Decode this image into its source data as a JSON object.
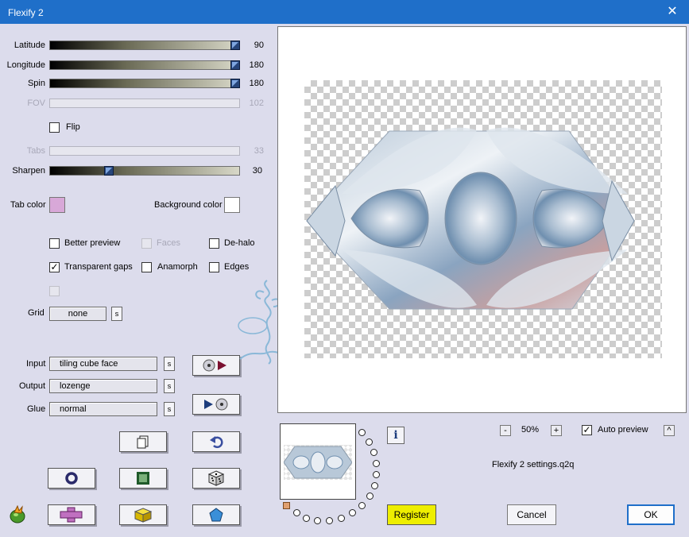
{
  "window": {
    "title": "Flexify 2",
    "close_icon": "close-icon"
  },
  "sliders": [
    {
      "label": "Latitude",
      "value": "90",
      "enabled": true,
      "level": 1.0
    },
    {
      "label": "Longitude",
      "value": "180",
      "enabled": true,
      "level": 1.0
    },
    {
      "label": "Spin",
      "value": "180",
      "enabled": true,
      "level": 1.0
    },
    {
      "label": "FOV",
      "value": "102",
      "enabled": false
    },
    {
      "label": "Tabs",
      "value": "33",
      "enabled": false
    },
    {
      "label": "Sharpen",
      "value": "30",
      "enabled": true,
      "level": 0.3
    }
  ],
  "flip": {
    "label": "Flip",
    "checked": false
  },
  "tab_color": {
    "label": "Tab color",
    "color": "#d8a8d8"
  },
  "background_color": {
    "label": "Background color",
    "color": "#ffffff"
  },
  "options": {
    "better_preview": {
      "label": "Better preview",
      "checked": false
    },
    "faces": {
      "label": "Faces",
      "checked": false,
      "enabled": false
    },
    "de_halo": {
      "label": "De-halo",
      "checked": false
    },
    "transparent_gaps": {
      "label": "Transparent gaps",
      "checked": true
    },
    "anamorph": {
      "label": "Anamorph",
      "checked": false
    },
    "edges": {
      "label": "Edges",
      "checked": false
    }
  },
  "grid": {
    "label": "Grid",
    "value": "none",
    "s": "s"
  },
  "input": {
    "label": "Input",
    "value": "tiling cube face",
    "s": "s"
  },
  "output": {
    "label": "Output",
    "value": "lozenge",
    "s": "s"
  },
  "glue": {
    "label": "Glue",
    "value": "normal",
    "s": "s"
  },
  "zoom": {
    "minus": "-",
    "value": "50%",
    "plus": "+"
  },
  "auto_preview": {
    "label": "Auto preview",
    "checked": true,
    "expand": "^"
  },
  "info": {
    "label": "i"
  },
  "settings_file": "Flexify 2 settings.q2q",
  "buttons": {
    "register": "Register",
    "cancel": "Cancel",
    "ok": "OK"
  },
  "colors": {
    "titlebar": "#1f6fc9",
    "dialog": "#dcdcec",
    "register": "#eeee00"
  }
}
